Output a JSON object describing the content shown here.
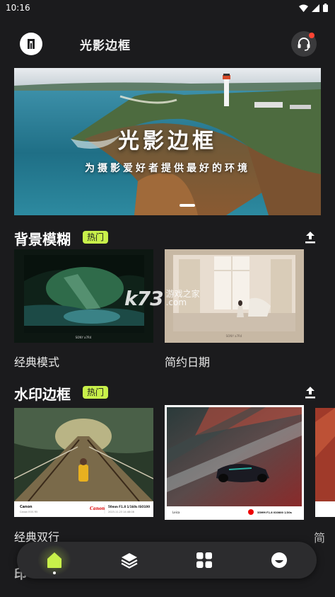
{
  "status_bar": {
    "time": "10:16"
  },
  "header": {
    "title": "光影边框"
  },
  "banner": {
    "title": "光影边框",
    "subtitle": "为摄影爱好者提供最好的环境"
  },
  "sections": [
    {
      "title": "背景模糊",
      "badge": "热门",
      "cards": [
        {
          "label": "经典模式",
          "caption": "SONY a7R4"
        },
        {
          "label": "简约日期",
          "caption": "SONY a7R4"
        }
      ]
    },
    {
      "title": "水印边框",
      "badge": "热门",
      "cards": [
        {
          "label": "经典双行",
          "brand": "Canon",
          "model": "Canon EOS R5",
          "lens_info": "50mm F1.8 1/160s ISO100",
          "date": "2023.11.23 14:48:08"
        },
        {
          "label": "",
          "brand": "Leica",
          "lens_info": "35MM F1.8 ISO800 1/30s"
        },
        {
          "label": "简"
        }
      ]
    },
    {
      "title": "印"
    }
  ],
  "watermark": {
    "logo": "k73",
    "text": "游戏之家",
    "domain": ".com"
  },
  "nav": {
    "items": [
      {
        "name": "home",
        "icon": "home-icon",
        "active": true
      },
      {
        "name": "layers",
        "icon": "layers-icon",
        "active": false
      },
      {
        "name": "apps",
        "icon": "grid-icon",
        "active": false
      },
      {
        "name": "profile",
        "icon": "face-icon",
        "active": false
      }
    ]
  },
  "colors": {
    "accent": "#c8f04a",
    "background": "#1b1b1d",
    "notification": "#ff4433"
  }
}
